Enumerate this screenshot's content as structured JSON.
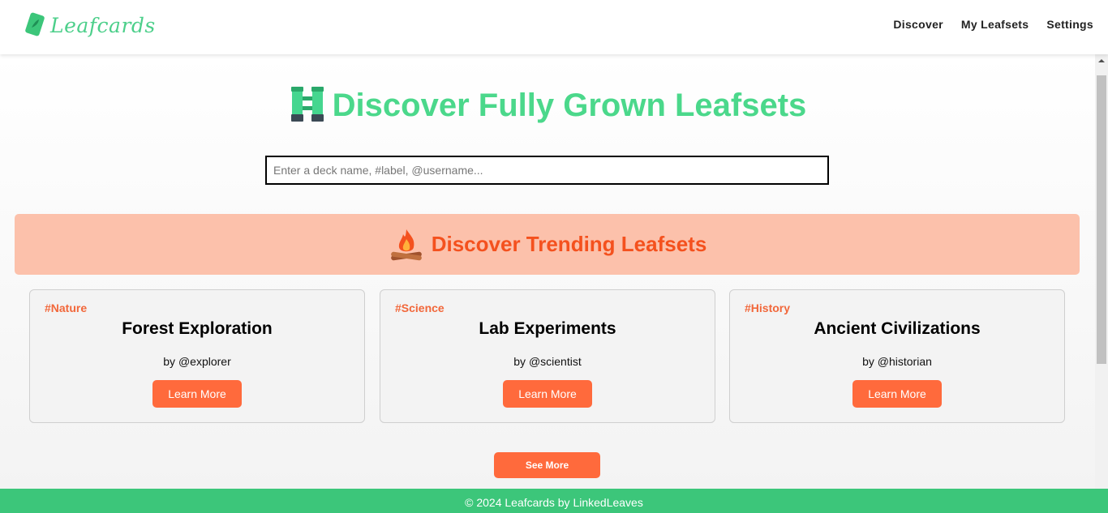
{
  "header": {
    "brand": "Leafcards",
    "nav": [
      "Discover",
      "My Leafsets",
      "Settings"
    ]
  },
  "hero": {
    "title": "Discover Fully Grown Leafsets",
    "icon": "binoculars-icon"
  },
  "search": {
    "placeholder": "Enter a deck name, #label, @username...",
    "value": ""
  },
  "trending": {
    "title": "Discover Trending Leafsets",
    "icon": "campfire-icon"
  },
  "cards": [
    {
      "label": "#Nature",
      "title": "Forest Exploration",
      "author": "by @explorer",
      "button": "Learn More"
    },
    {
      "label": "#Science",
      "title": "Lab Experiments",
      "author": "by @scientist",
      "button": "Learn More"
    },
    {
      "label": "#History",
      "title": "Ancient Civilizations",
      "author": "by @historian",
      "button": "Learn More"
    }
  ],
  "see_more": "See More",
  "footer": "© 2024 Leafcards by LinkedLeaves",
  "colors": {
    "brand_green": "#4bd88b",
    "footer_green": "#3cc67a",
    "accent_orange": "#ff6a3c",
    "banner_peach": "#fcc1ab",
    "trending_text": "#f4511e"
  }
}
